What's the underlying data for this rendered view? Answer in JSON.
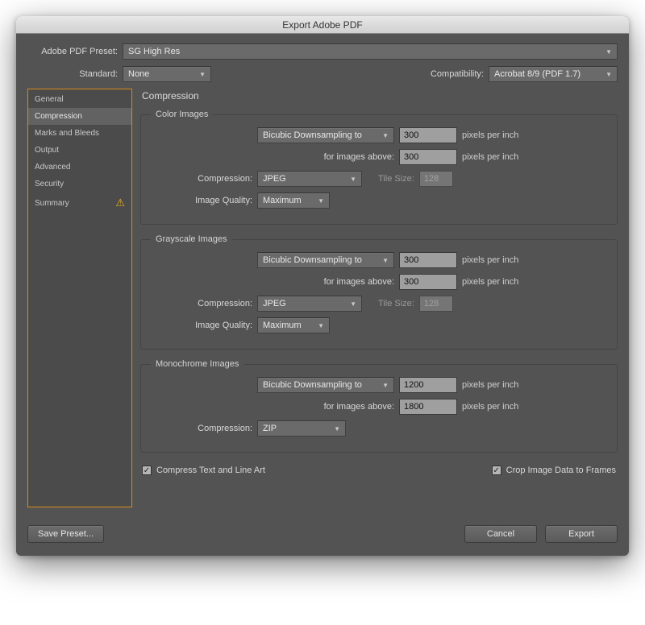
{
  "window": {
    "title": "Export Adobe PDF"
  },
  "top": {
    "preset_label": "Adobe PDF Preset:",
    "preset_value": "SG High Res",
    "standard_label": "Standard:",
    "standard_value": "None",
    "compat_label": "Compatibility:",
    "compat_value": "Acrobat 8/9 (PDF 1.7)"
  },
  "sidebar": {
    "items": [
      {
        "label": "General"
      },
      {
        "label": "Compression"
      },
      {
        "label": "Marks and Bleeds"
      },
      {
        "label": "Output"
      },
      {
        "label": "Advanced"
      },
      {
        "label": "Security"
      },
      {
        "label": "Summary"
      }
    ],
    "selected_index": 1,
    "warning_glyph": "⚠"
  },
  "panel": {
    "title": "Compression"
  },
  "labels": {
    "for_images_above": "for images above:",
    "compression": "Compression:",
    "image_quality": "Image Quality:",
    "ppi": "pixels per inch",
    "tile_size": "Tile Size:"
  },
  "color": {
    "legend": "Color Images",
    "downsample": "Bicubic Downsampling to",
    "ppi": "300",
    "above_ppi": "300",
    "compression": "JPEG",
    "tile": "128",
    "quality": "Maximum"
  },
  "gray": {
    "legend": "Grayscale Images",
    "downsample": "Bicubic Downsampling to",
    "ppi": "300",
    "above_ppi": "300",
    "compression": "JPEG",
    "tile": "128",
    "quality": "Maximum"
  },
  "mono": {
    "legend": "Monochrome Images",
    "downsample": "Bicubic Downsampling to",
    "ppi": "1200",
    "above_ppi": "1800",
    "compression": "ZIP"
  },
  "checks": {
    "compress_text": "Compress Text and Line Art",
    "crop_image": "Crop Image Data to Frames",
    "check_glyph": "✓"
  },
  "footer": {
    "save_preset": "Save Preset...",
    "cancel": "Cancel",
    "export": "Export"
  }
}
